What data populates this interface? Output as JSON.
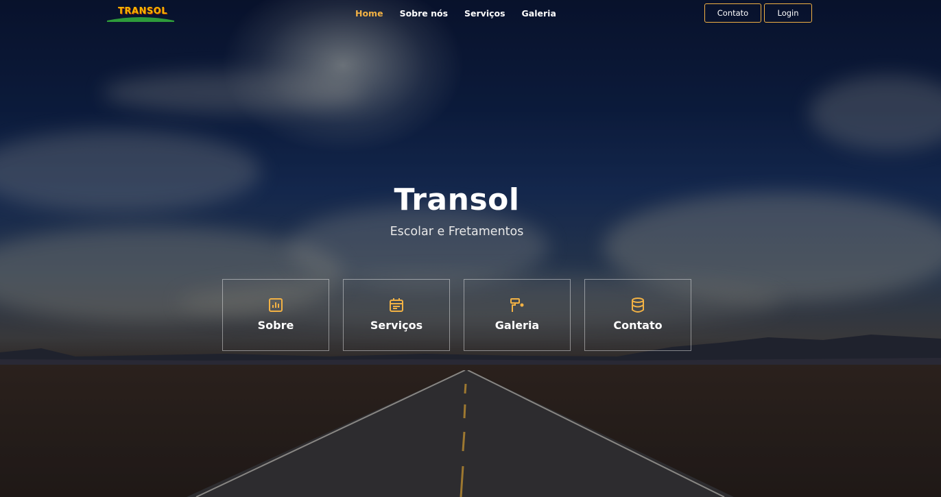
{
  "brand": {
    "logo_text": "TRANSOL"
  },
  "nav": {
    "links": [
      {
        "label": "Home",
        "active": true
      },
      {
        "label": "Sobre nós",
        "active": false
      },
      {
        "label": "Serviços",
        "active": false
      },
      {
        "label": "Galeria",
        "active": false
      }
    ],
    "buttons": {
      "contato": "Contato",
      "login": "Login"
    }
  },
  "hero": {
    "title": "Transol",
    "subtitle": "Escolar e Fretamentos",
    "cards": [
      {
        "label": "Sobre",
        "icon": "bar-chart-icon"
      },
      {
        "label": "Serviços",
        "icon": "calendar-icon"
      },
      {
        "label": "Galeria",
        "icon": "paint-roller-icon"
      },
      {
        "label": "Contato",
        "icon": "database-icon"
      }
    ]
  },
  "colors": {
    "accent": "#f3b244",
    "text": "#ffffff",
    "sky_dark": "#0b1533"
  }
}
